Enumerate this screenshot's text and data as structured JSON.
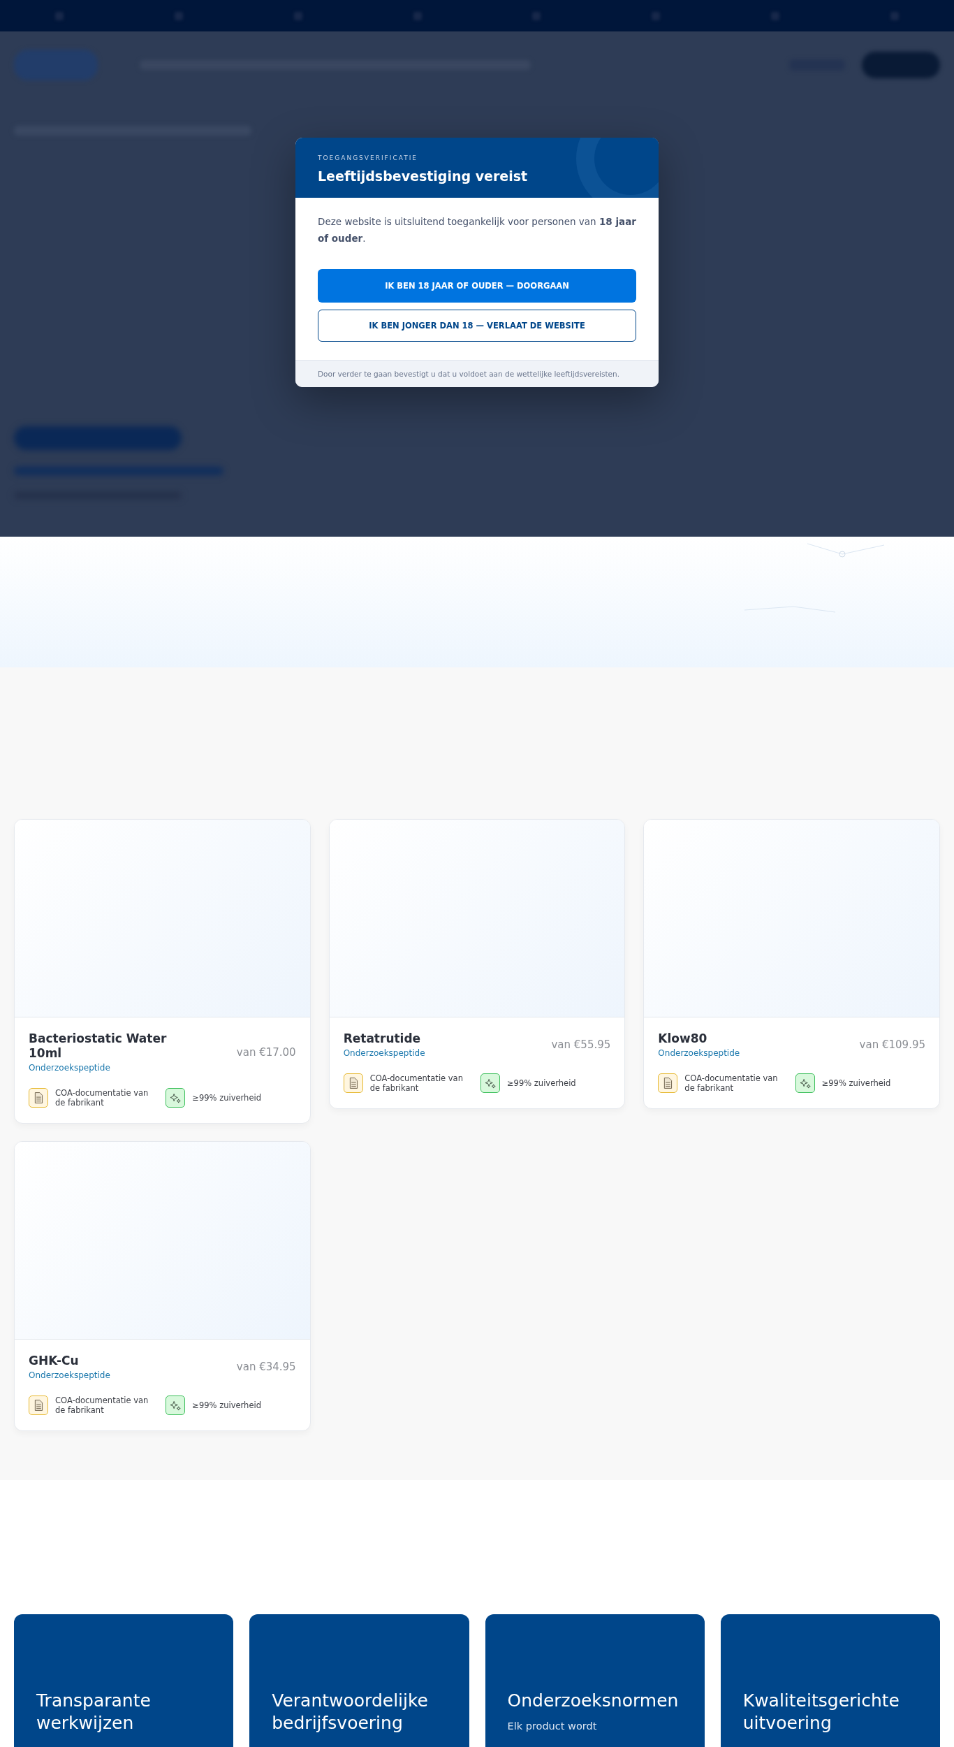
{
  "age_gate": {
    "eyebrow": "TOEGANGSVERIFICATIE",
    "title": "Leeftijdsbevestiging vereist",
    "message": "Deze website is uitsluitend toegankelijk voor personen van **18 jaar of ouder**.",
    "buttons": [
      {
        "label": "IK BEN 18 JAAR OF OUDER — DOORGAAN",
        "kind": "primary"
      },
      {
        "label": "IK BEN JONGER DAN 18 — VERLAAT DE WEBSITE",
        "kind": "secondary"
      }
    ],
    "footnote": "Door verder te gaan bevestigt u dat u voldoet aan de wettelijke leeftijdsvereisten."
  },
  "products": [
    {
      "name": "Bacteriostatic Water 10ml",
      "category": "Onderzoekspeptide",
      "price": "van €17.00",
      "features": [
        {
          "kind": "document",
          "label": "COA-documentatie van de fabrikant"
        },
        {
          "kind": "purity",
          "label": "≥99% zuiverheid"
        }
      ]
    },
    {
      "name": "Retatrutide",
      "category": "Onderzoekspeptide",
      "price": "van €55.95",
      "features": [
        {
          "kind": "document",
          "label": "COA-documentatie van de fabrikant"
        },
        {
          "kind": "purity",
          "label": "≥99% zuiverheid"
        }
      ]
    },
    {
      "name": "Klow80",
      "category": "Onderzoekspeptide",
      "price": "van €109.95",
      "features": [
        {
          "kind": "document",
          "label": "COA-documentatie van de fabrikant"
        },
        {
          "kind": "purity",
          "label": "≥99% zuiverheid"
        }
      ]
    },
    {
      "name": "GHK-Cu",
      "category": "Onderzoekspeptide",
      "price": "van €34.95",
      "features": [
        {
          "kind": "document",
          "label": "COA-documentatie van de fabrikant"
        },
        {
          "kind": "purity",
          "label": "≥99% zuiverheid"
        }
      ]
    }
  ],
  "values": [
    {
      "title": "Transparante werkwijzen"
    },
    {
      "title": "Verantwoordelijke bedrijfsvoering"
    },
    {
      "title": "Onderzoeksnormen",
      "text": "Elk product wordt"
    },
    {
      "title": "Kwaliteitsgerichte uitvoering"
    }
  ]
}
